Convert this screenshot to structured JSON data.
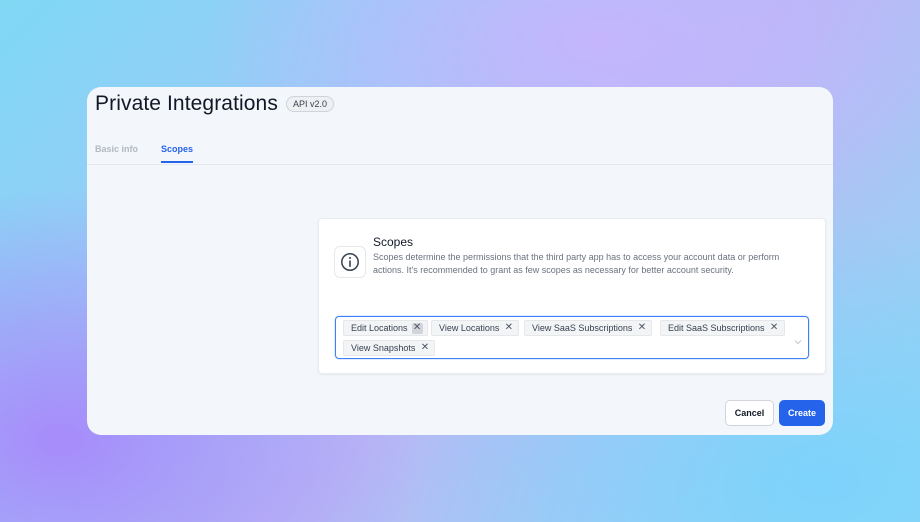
{
  "header": {
    "title": "Private Integrations",
    "badge": "API v2.0"
  },
  "tabs": [
    {
      "label": "Basic info",
      "active": false
    },
    {
      "label": "Scopes",
      "active": true
    }
  ],
  "scopes_card": {
    "icon": "info-icon",
    "title": "Scopes",
    "description": "Scopes determine the permissions that the third party app has to access your account data or perform actions. It's recommended to grant as few scopes as necessary for better account security.",
    "selected_scopes": [
      "Edit Locations",
      "View Locations",
      "View SaaS Subscriptions",
      "Edit SaaS Subscriptions",
      "View Snapshots"
    ],
    "remove_glyph": "✕"
  },
  "footer": {
    "cancel_label": "Cancel",
    "create_label": "Create"
  },
  "colors": {
    "accent": "#2563eb",
    "panel_bg": "#f3f6fa"
  }
}
